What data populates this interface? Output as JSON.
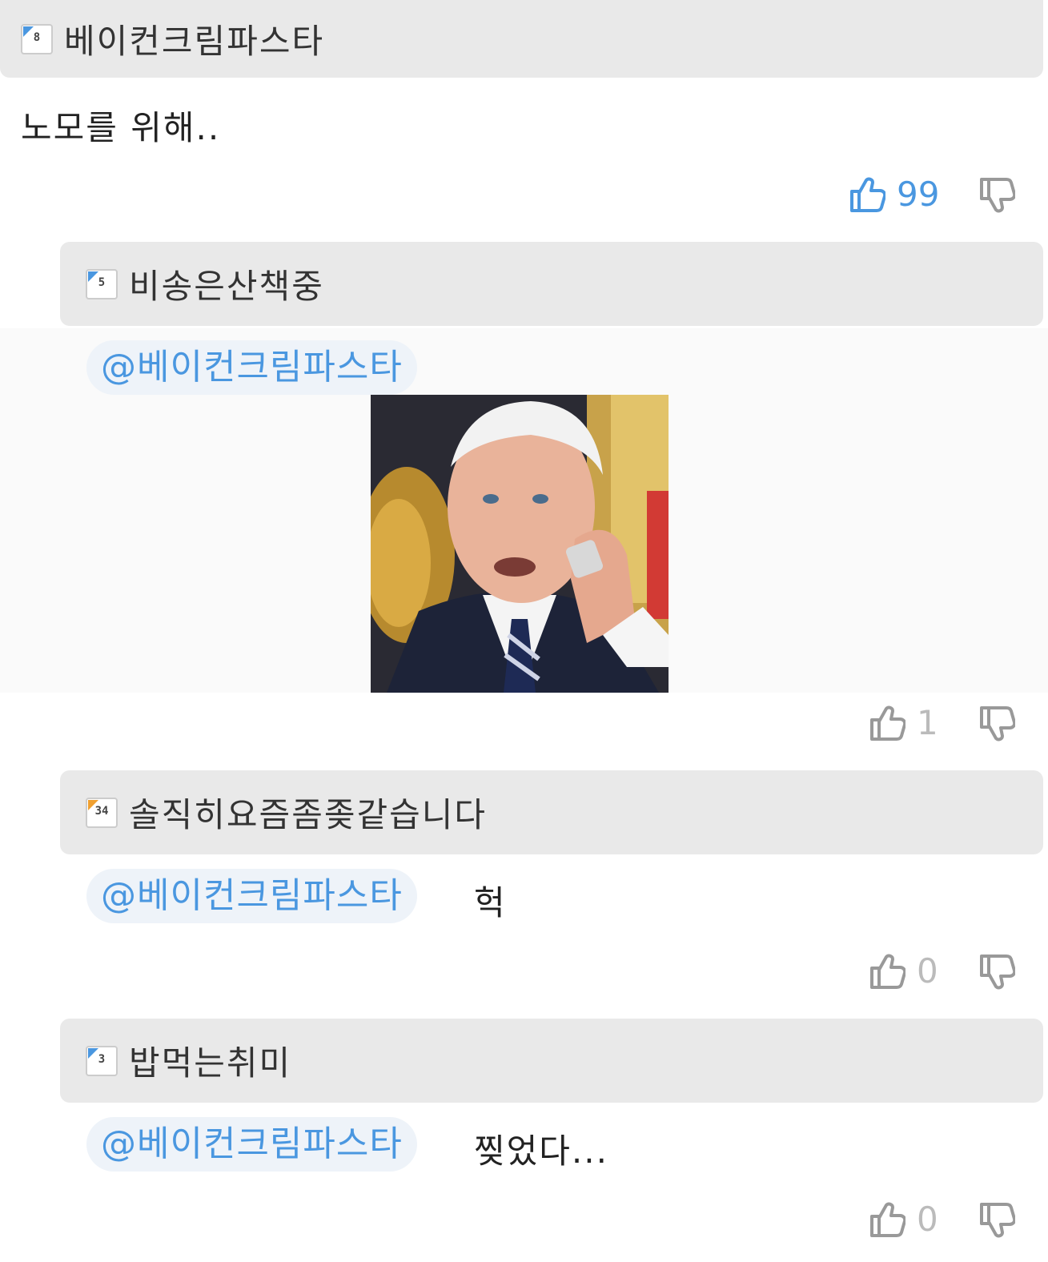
{
  "comments": [
    {
      "author": "베이컨크림파스타",
      "level": "8",
      "text": "노모를 위해..",
      "likes": "99",
      "liked": true
    },
    {
      "author": "비송은산책중",
      "level": "5",
      "mention": "@베이컨크림파스타",
      "text": "",
      "likes": "1",
      "has_image": true
    },
    {
      "author": "솔직히요즘좀좆같습니다",
      "level": "34",
      "mention": "@베이컨크림파스타",
      "text": "헉",
      "likes": "0"
    },
    {
      "author": "밥먹는취미",
      "level": "3",
      "mention": "@베이컨크림파스타",
      "text": "찢었다...",
      "likes": "0"
    }
  ],
  "colors": {
    "accent": "#4a97e0",
    "header_bg": "#e9e9e9",
    "mention_bg": "#eef3f9"
  },
  "icons": {
    "like": "thumbs-up-icon",
    "dislike": "thumbs-down-icon",
    "level": "level-badge-icon"
  }
}
